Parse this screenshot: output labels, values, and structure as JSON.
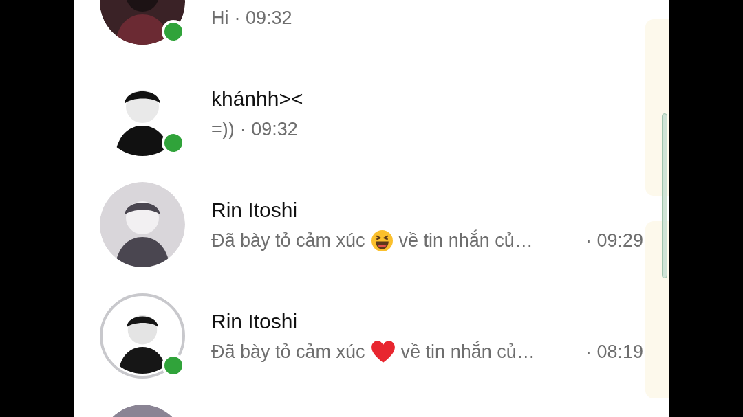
{
  "conversations": [
    {
      "message": "Hi",
      "time": "· 09:32",
      "online": true,
      "story_ring": false
    },
    {
      "name": "khánhh><",
      "message": "=))",
      "time": "· 09:32",
      "online": true,
      "story_ring": false
    },
    {
      "name": "Rin Itoshi",
      "message": "Đã bày tỏ cảm xúc",
      "reaction": {
        "kind": "laughing"
      },
      "message_end": "về tin nhắn củ…",
      "time": "· 09:29",
      "online": false,
      "story_ring": false
    },
    {
      "name": "Rin Itoshi",
      "message": "Đã bày tỏ cảm xúc",
      "reaction": {
        "kind": "heart"
      },
      "message_end": "về tin nhắn củ…",
      "time": "· 08:19",
      "online": true,
      "story_ring": true
    },
    {
      "online": false,
      "story_ring": false
    }
  ]
}
